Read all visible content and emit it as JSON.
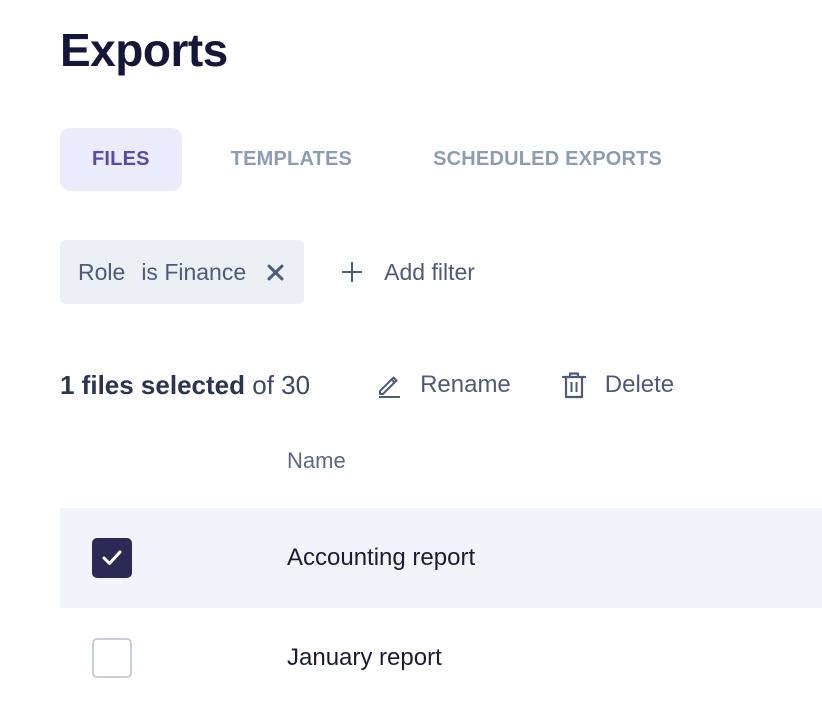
{
  "page": {
    "title": "Exports"
  },
  "tabs": [
    {
      "label": "FILES",
      "active": true
    },
    {
      "label": "TEMPLATES",
      "active": false
    },
    {
      "label": "SCHEDULED EXPORTS",
      "active": false
    }
  ],
  "filters": {
    "chips": [
      {
        "field": "Role",
        "operator_value": "is Finance",
        "remove_icon": "close-icon"
      }
    ],
    "add_label": "Add filter",
    "add_icon": "plus-icon"
  },
  "toolbar": {
    "selected_text": "1 files selected",
    "total_text": "of 30",
    "rename_label": "Rename",
    "rename_icon": "pencil-icon",
    "delete_label": "Delete",
    "delete_icon": "trash-icon"
  },
  "table": {
    "columns": [
      {
        "label": "Name"
      }
    ],
    "rows": [
      {
        "name": "Accounting report",
        "checked": true
      },
      {
        "name": "January report",
        "checked": false
      }
    ]
  },
  "colors": {
    "accent": "#5a4aa6",
    "active_tab_bg": "#ebebfb",
    "checkbox_checked": "#2a2a55",
    "selected_row_bg": "#f1f4f9"
  }
}
